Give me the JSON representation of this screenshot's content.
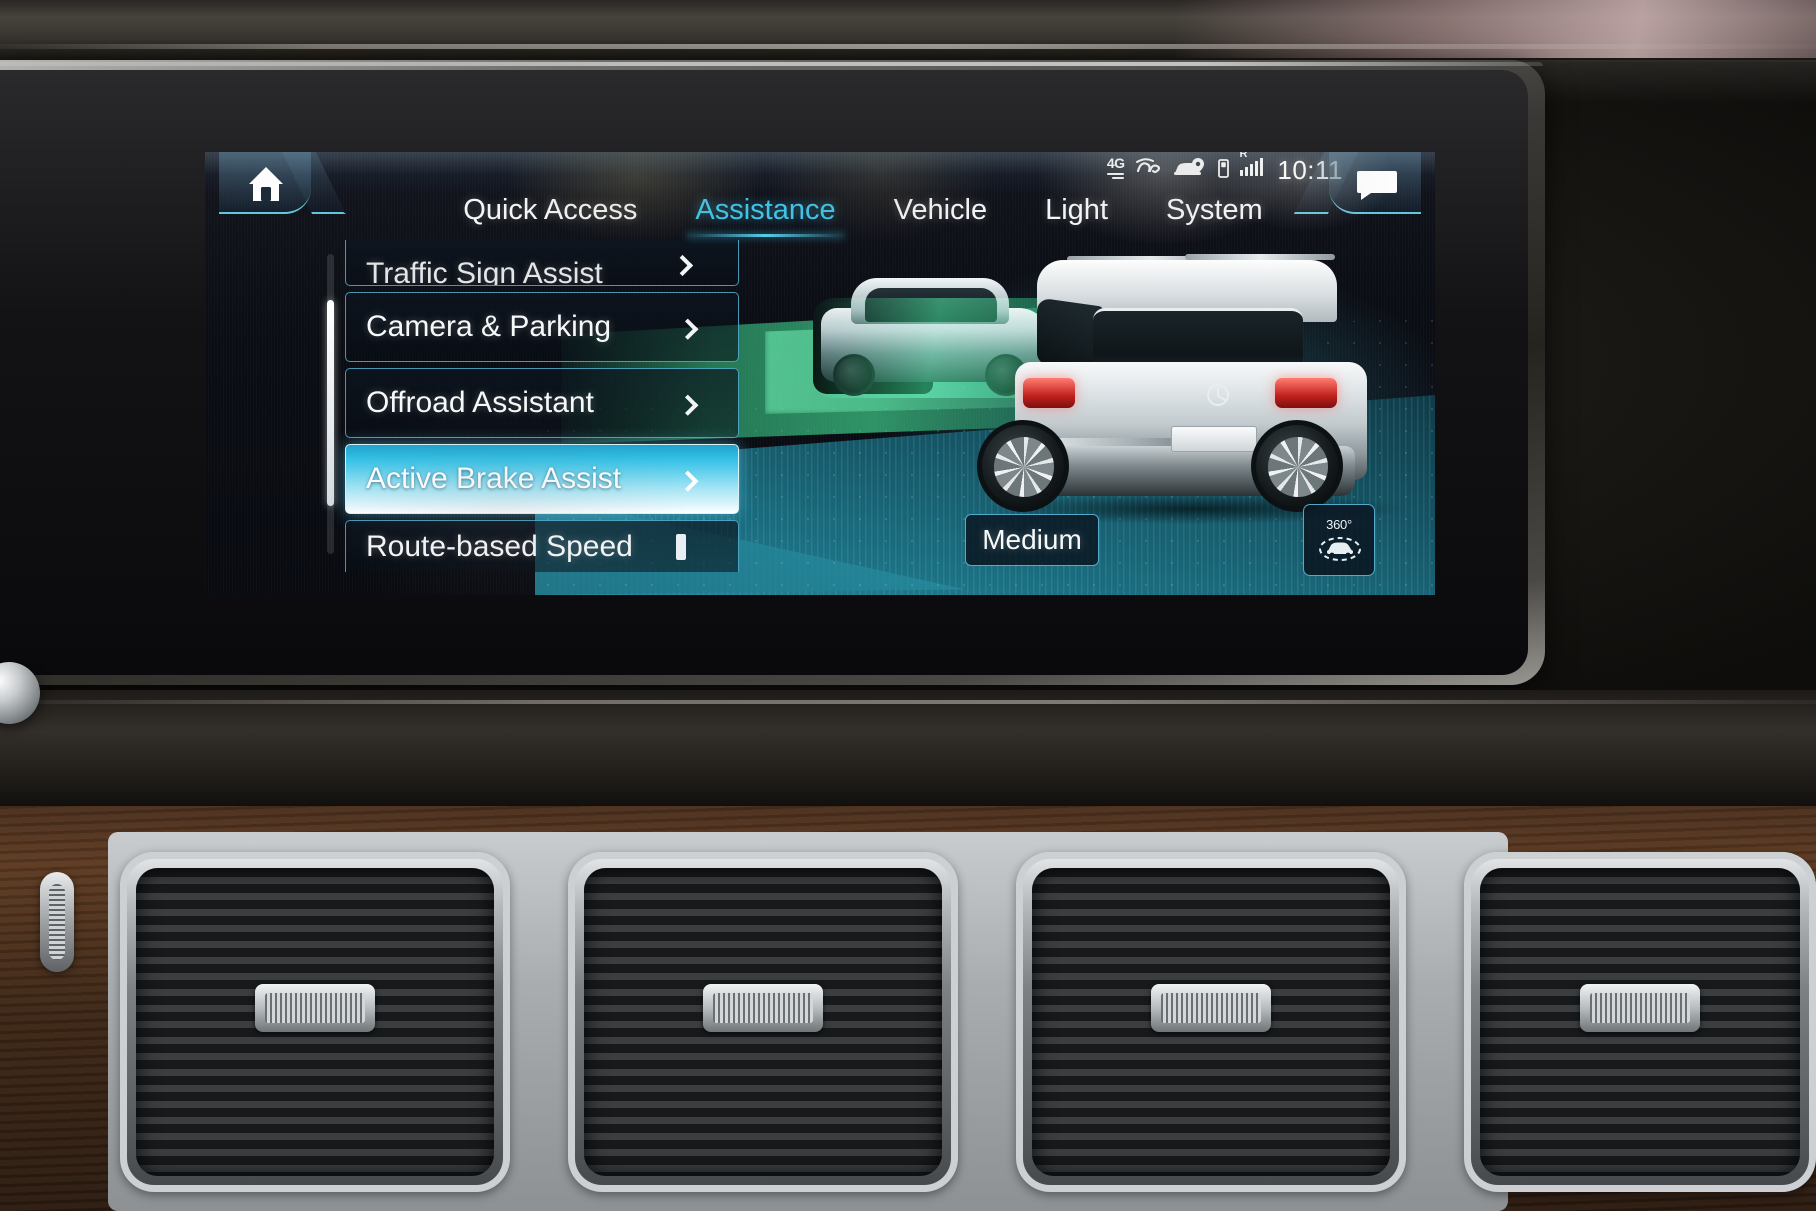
{
  "screen": {
    "status_bar": {
      "network_label": "4G",
      "mercedes_me_icon": "mercedes-me-icon",
      "car_location_icon": "car-location-icon",
      "sim_icon": "sim-card-icon",
      "roaming_label": "R",
      "signal_icon": "signal-bars-icon",
      "clock": "10:11"
    },
    "home_button": {
      "icon": "home-icon",
      "label": "Home"
    },
    "message_button": {
      "icon": "message-bubble-icon",
      "label": "Messages"
    },
    "tabs": [
      {
        "label": "Quick Access",
        "active": false
      },
      {
        "label": "Assistance",
        "active": true
      },
      {
        "label": "Vehicle",
        "active": false
      },
      {
        "label": "Light",
        "active": false
      },
      {
        "label": "System",
        "active": false
      }
    ],
    "menu": {
      "items": [
        {
          "label": "Traffic Sign Assist",
          "state": "clipped-top",
          "chevron": true
        },
        {
          "label": "Camera & Parking",
          "state": "normal",
          "chevron": true
        },
        {
          "label": "Offroad Assistant",
          "state": "normal",
          "chevron": true
        },
        {
          "label": "Active Brake Assist",
          "state": "selected",
          "chevron": true
        },
        {
          "label": "Route-based Speed",
          "state": "clipped-bottom",
          "chevron": true
        }
      ]
    },
    "controls": {
      "sensitivity_value": "Medium",
      "camera_button": {
        "degrees_label": "360°",
        "icon": "surround-view-camera-icon"
      }
    },
    "illustration": {
      "description": "Rear view of white SUV with green radar detection cone toward leading vehicle",
      "leading_vehicle_icon": "leading-car-icon",
      "ego_vehicle_icon": "suv-rear-icon",
      "detection_cone_icon": "radar-cone-icon"
    },
    "colors": {
      "accent_cyan": "#3fc3e6",
      "selection_gradient_start": "#1fa3cd",
      "selection_gradient_end": "#ffffff",
      "text_primary": "#f6f8f9",
      "detection_green": "#46e69b",
      "road_teal": "#1d7b8e"
    }
  }
}
